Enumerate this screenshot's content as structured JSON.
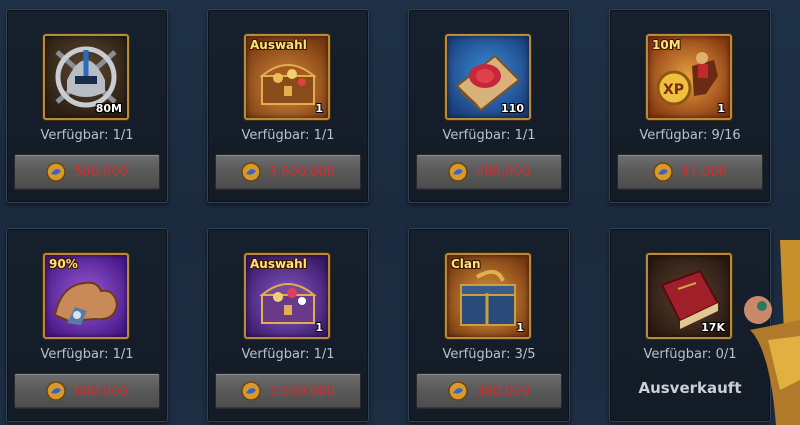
{
  "shop": {
    "items": [
      {
        "tag": "",
        "qty": "80M",
        "availability": "Verfügbar: 1/1",
        "price": "500,000",
        "icon": "helmet-emblem-icon",
        "sold_out": ""
      },
      {
        "tag": "Auswahl",
        "qty": "1",
        "availability": "Verfügbar: 1/1",
        "price": "3,600,000",
        "icon": "treasure-chest-icon",
        "sold_out": ""
      },
      {
        "tag": "",
        "qty": "110",
        "availability": "Verfügbar: 1/1",
        "price": "480,000",
        "icon": "scroll-icon",
        "sold_out": ""
      },
      {
        "tag": "10M",
        "qty": "1",
        "availability": "Verfügbar: 9/16",
        "price": "41,000",
        "icon": "xp-rider-icon",
        "sold_out": ""
      },
      {
        "tag": "90%",
        "qty": "",
        "availability": "Verfügbar: 1/1",
        "price": "600,000",
        "icon": "muscle-arm-icon",
        "sold_out": ""
      },
      {
        "tag": "Auswahl",
        "qty": "1",
        "availability": "Verfügbar: 1/1",
        "price": "3,600,000",
        "icon": "purple-chest-icon",
        "sold_out": ""
      },
      {
        "tag": "Clan",
        "qty": "1",
        "availability": "Verfügbar: 3/5",
        "price": "360,000",
        "icon": "clan-chest-icon",
        "sold_out": ""
      },
      {
        "tag": "",
        "qty": "17K",
        "availability": "Verfügbar: 0/1",
        "price": "",
        "icon": "red-book-icon",
        "sold_out": "Ausverkauft"
      }
    ]
  },
  "colors": {
    "background": "#1d2d40",
    "card": "#151e2a",
    "price_red": "#d82c2c",
    "gold_frame": "#b88a3a"
  }
}
